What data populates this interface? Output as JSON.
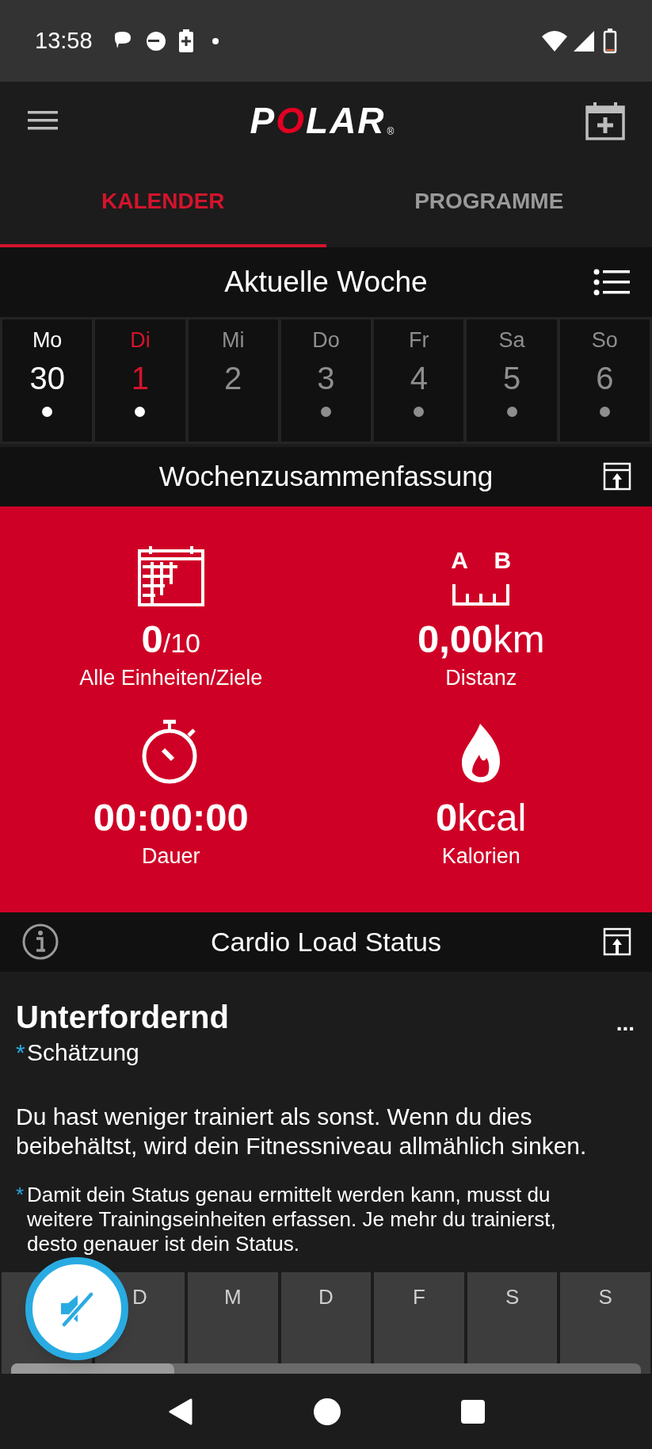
{
  "status_bar": {
    "time": "13:58"
  },
  "app_bar": {
    "logo": "POLAR",
    "logo_mark": "®"
  },
  "tabs": [
    {
      "label": "KALENDER",
      "selected": true
    },
    {
      "label": "PROGRAMME",
      "selected": false
    }
  ],
  "week": {
    "title": "Aktuelle Woche",
    "days": [
      {
        "label": "Mo",
        "date": "30",
        "kind": "past",
        "dot": true
      },
      {
        "label": "Di",
        "date": "1",
        "kind": "today",
        "dot": true
      },
      {
        "label": "Mi",
        "date": "2",
        "kind": "future",
        "dot": false
      },
      {
        "label": "Do",
        "date": "3",
        "kind": "future",
        "dot": true
      },
      {
        "label": "Fr",
        "date": "4",
        "kind": "future",
        "dot": true
      },
      {
        "label": "Sa",
        "date": "5",
        "kind": "future",
        "dot": true
      },
      {
        "label": "So",
        "date": "6",
        "kind": "future",
        "dot": true
      }
    ]
  },
  "summary": {
    "title": "Wochenzusammenfassung",
    "distance_icon_labels": [
      "A",
      "B"
    ],
    "metrics": [
      {
        "kind": "sessions",
        "value": "0",
        "unit": "/10",
        "small_unit": true,
        "label": "Alle Einheiten/Ziele"
      },
      {
        "kind": "distance",
        "value": "0,00",
        "unit": "km",
        "label": "Distanz"
      },
      {
        "kind": "duration",
        "value": "00:00:00",
        "label": "Dauer"
      },
      {
        "kind": "calories",
        "value": "0",
        "unit": "kcal",
        "label": "Kalorien"
      }
    ]
  },
  "cardio": {
    "title": "Cardio Load Status",
    "status": "Unterfordernd",
    "more": "...",
    "estimate": {
      "mark": "*",
      "text": "Schätzung"
    },
    "description": "Du hast weniger trainiert als sonst. Wenn du dies beibehältst, wird dein Fitnessniveau allmählich sinken.",
    "footnote": {
      "mark": "*",
      "text": "Damit dein Status genau ermittelt werden kann, musst du weitere Trainingseinheiten erfassen. Je mehr du trainierst, desto genauer ist dein Status."
    },
    "days": [
      "D",
      "M",
      "D",
      "F",
      "S",
      "S"
    ]
  }
}
